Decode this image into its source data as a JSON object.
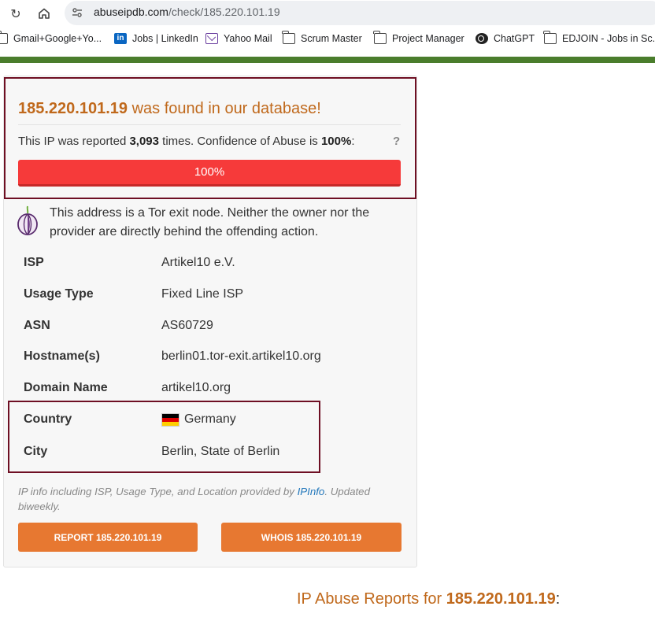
{
  "browser": {
    "url_host": "abuseipdb.com",
    "url_path": "/check/185.220.101.19",
    "bookmarks": [
      {
        "label": "Gmail+Google+Yo...",
        "icon": "folder-icon"
      },
      {
        "label": "Jobs | LinkedIn",
        "icon": "linkedin-icon"
      },
      {
        "label": "Yahoo Mail",
        "icon": "mail-icon"
      },
      {
        "label": "Scrum Master",
        "icon": "folder-icon"
      },
      {
        "label": "Project Manager",
        "icon": "folder-icon"
      },
      {
        "label": "ChatGPT",
        "icon": "chatgpt-icon"
      },
      {
        "label": "EDJOIN - Jobs in Sc...",
        "icon": "folder-icon"
      }
    ]
  },
  "result": {
    "ip": "185.220.101.19",
    "found_suffix": " was found in our database!",
    "reported_prefix": "This IP was reported ",
    "report_count": "3,093",
    "reported_middle": " times. Confidence of Abuse is ",
    "confidence": "100%",
    "reported_suffix": ":",
    "help": "?",
    "progress_label": "100%",
    "confidence_fraction": 1.0
  },
  "tor": {
    "text": "This address is a Tor exit node. Neither the owner nor the provider are directly behind the offending action."
  },
  "details": [
    {
      "key": "ISP",
      "value": "Artikel10 e.V."
    },
    {
      "key": "Usage Type",
      "value": "Fixed Line ISP"
    },
    {
      "key": "ASN",
      "value": "AS60729"
    },
    {
      "key": "Hostname(s)",
      "value": "berlin01.tor-exit.artikel10.org"
    },
    {
      "key": "Domain Name",
      "value": "artikel10.org"
    },
    {
      "key": "Country",
      "value": "Germany"
    },
    {
      "key": "City",
      "value": "Berlin, State of Berlin"
    }
  ],
  "note": {
    "prefix": "IP info including ISP, Usage Type, and Location provided by ",
    "link": "IPInfo",
    "suffix": ". Updated biweekly."
  },
  "buttons": {
    "report": "REPORT 185.220.101.19",
    "whois": "WHOIS 185.220.101.19"
  },
  "reports_heading": {
    "prefix": "IP Abuse Reports for ",
    "ip": "185.220.101.19",
    "suffix": ":"
  },
  "colors": {
    "accent_orange": "#c0691c",
    "button_orange": "#e77831",
    "danger_red": "#f63a3a",
    "highlight_border": "#6e0f23",
    "header_green": "#4a7d2c"
  }
}
